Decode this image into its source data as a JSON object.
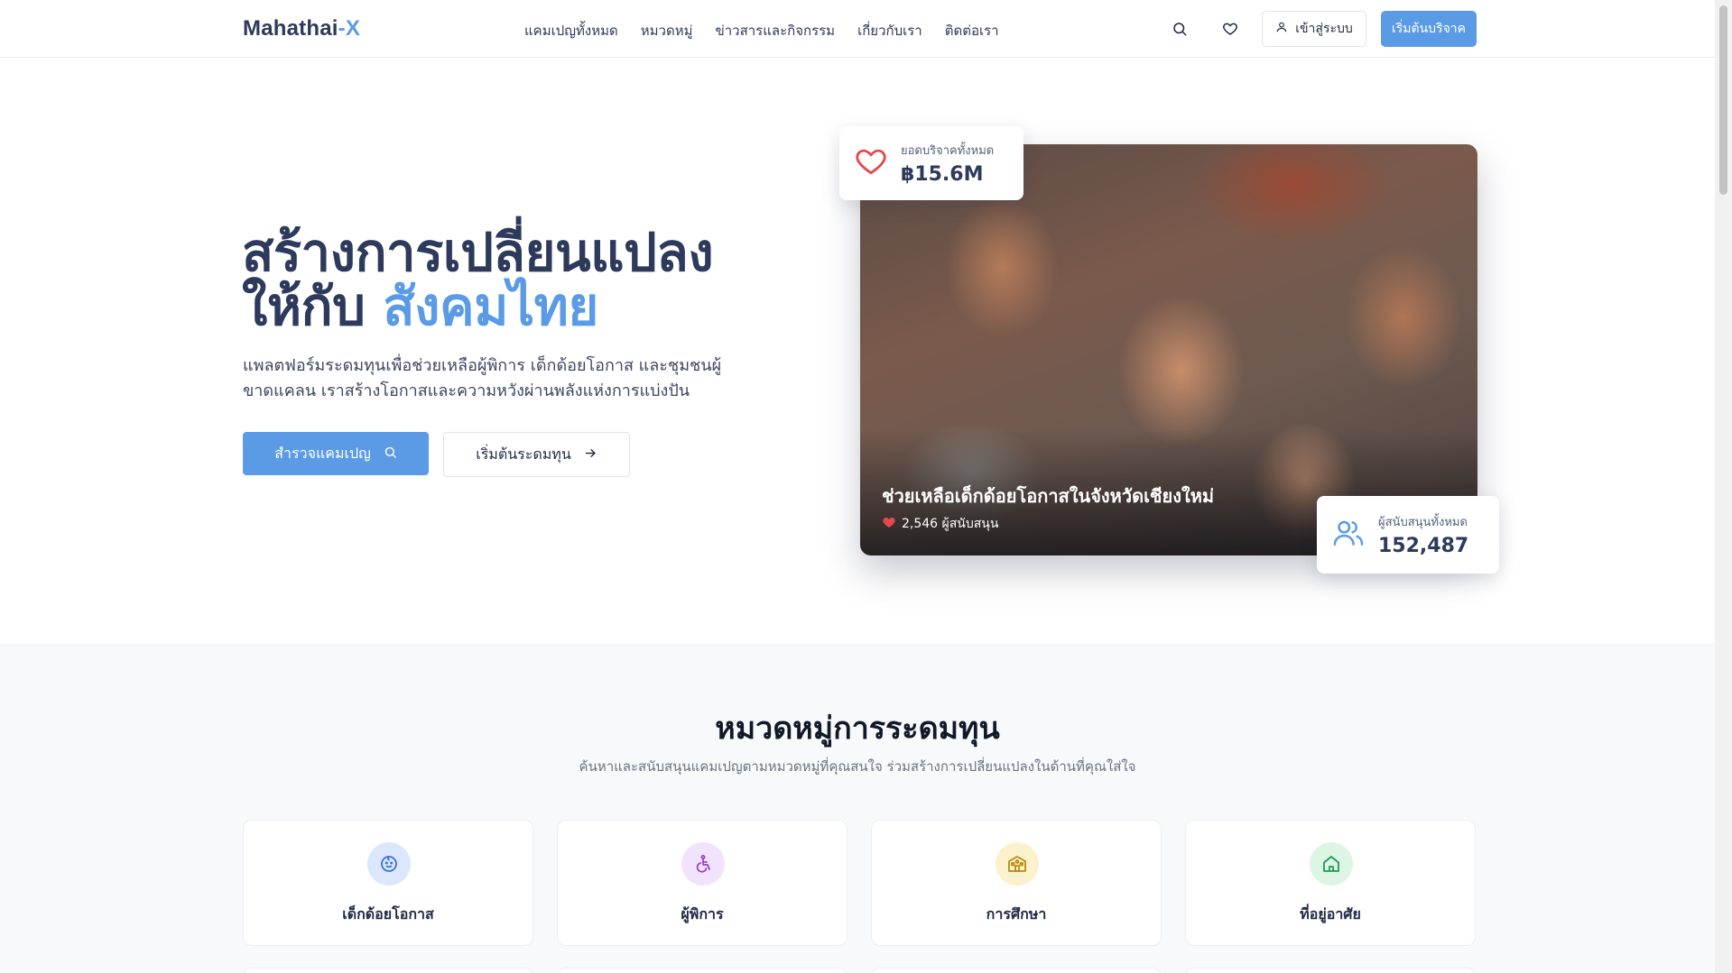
{
  "nav": {
    "brand_main": "Mahathai",
    "brand_accent": "-X",
    "menu": [
      {
        "label": "แคมเปญทั้งหมด"
      },
      {
        "label": "หมวดหมู่"
      },
      {
        "label": "ข่าวสารและกิจกรรม"
      },
      {
        "label": "เกี่ยวกับเรา"
      },
      {
        "label": "ติดต่อเรา"
      }
    ],
    "login_label": "เข้าสู่ระบบ",
    "donate_label": "เริ่มต้นบริจาค"
  },
  "hero": {
    "title_line1": "สร้างการเปลี่ยนแปลง",
    "title_line2_prefix": "ให้กับ",
    "title_line2_highlight": "สังคมไทย",
    "description": "แพลตฟอร์มระดมทุนเพื่อช่วยเหลือผู้พิการ เด็กด้อยโอกาส และชุมชนผู้ขาดแคลน เราสร้างโอกาสและความหวังผ่านพลังแห่งการแบ่งปัน",
    "explore_button": "สำรวจแคมเปญ",
    "start_button": "เริ่มต้นระดมทุน"
  },
  "featured": {
    "caption": "ช่วยเหลือเด็กด้อยโอกาสในจังหวัดเชียงใหม่",
    "supporters": "2,546 ผู้สนับสนุน"
  },
  "stats": {
    "total_label": "ยอดบริจาคทั้งหมด",
    "total_value": "฿15.6M",
    "people_label": "ผู้สนับสนุนทั้งหมด",
    "people_value": "152,487"
  },
  "categories": {
    "title": "หมวดหมู่การระดมทุน",
    "subtitle": "ค้นหาและสนับสนุนแคมเปญตามหมวดหมู่ที่คุณสนใจ ร่วมสร้างการเปลี่ยนแปลงในด้านที่คุณใส่ใจ",
    "items": [
      {
        "label": "เด็กด้อยโอกาส",
        "icon": "baby-face-icon",
        "color": "#3b6fd8",
        "bg": "#dbe7fb"
      },
      {
        "label": "ผู้พิการ",
        "icon": "accessibility-icon",
        "color": "#9b3fd6",
        "bg": "#f1e3fb"
      },
      {
        "label": "การศึกษา",
        "icon": "school-icon",
        "color": "#b98a0c",
        "bg": "#fbf1cc"
      },
      {
        "label": "ที่อยู่อาศัย",
        "icon": "home-icon",
        "color": "#1f9a52",
        "bg": "#dcf5e5"
      }
    ]
  },
  "colors": {
    "primary": "#5b9be6",
    "heading": "#2d3a5c",
    "heart": "#e5484d"
  }
}
